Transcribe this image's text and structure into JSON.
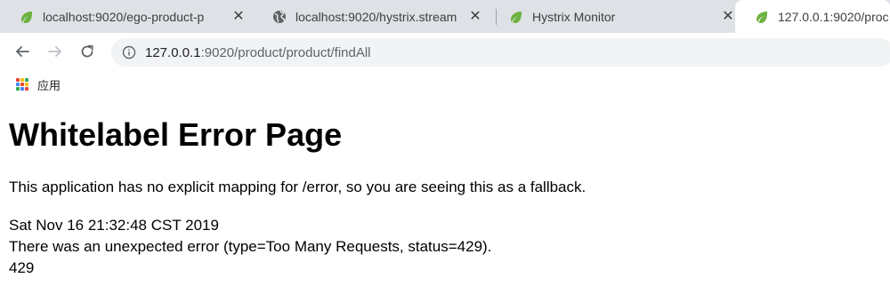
{
  "browser": {
    "tabs": [
      {
        "title": "localhost:9020/ego-product-p",
        "favicon": "spring-leaf-icon",
        "active": false
      },
      {
        "title": "localhost:9020/hystrix.stream",
        "favicon": "globe-icon",
        "active": false
      },
      {
        "title": "Hystrix Monitor",
        "favicon": "spring-leaf-icon",
        "active": false
      },
      {
        "title": "127.0.0.1:9020/proc",
        "favicon": "spring-leaf-icon",
        "active": true
      }
    ],
    "address": {
      "host": "127.0.0.1",
      "rest": ":9020/product/product/findAll"
    },
    "bookmarks": {
      "apps_label": "应用"
    },
    "colors": {
      "tabstrip": "#dee1e6",
      "omnibox": "#f1f3f4",
      "spring_green": "#6db33f"
    }
  },
  "page": {
    "heading": "Whitelabel Error Page",
    "description": "This application has no explicit mapping for /error, so you are seeing this as a fallback.",
    "timestamp": "Sat Nov 16 21:32:48 CST 2019",
    "error_line": "There was an unexpected error (type=Too Many Requests, status=429).",
    "status_code": "429"
  }
}
